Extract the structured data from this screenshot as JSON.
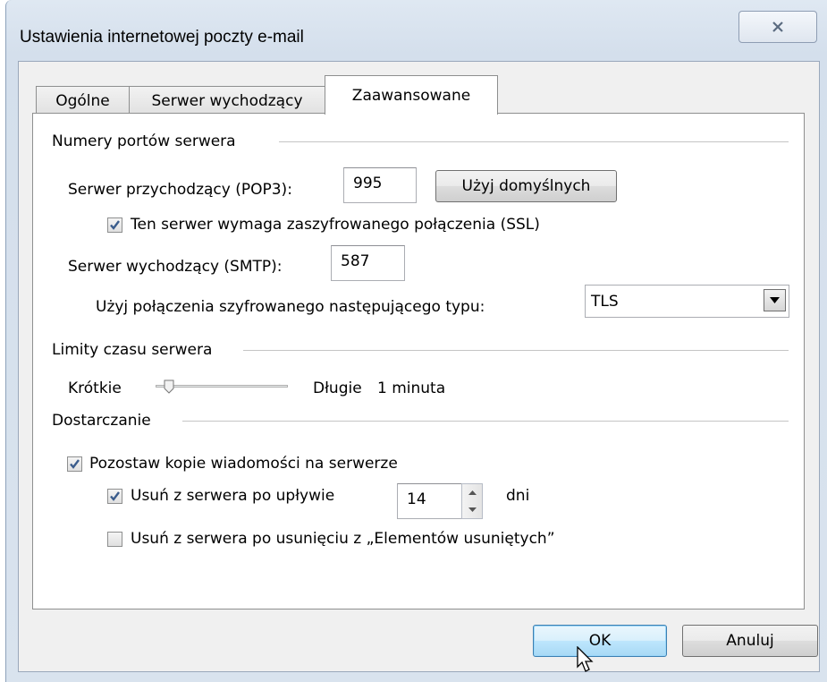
{
  "window": {
    "title": "Ustawienia internetowej poczty e-mail",
    "close_icon": "close-icon"
  },
  "tabs": [
    {
      "label": "Ogólne",
      "active": false
    },
    {
      "label": "Serwer wychodzący",
      "active": false
    },
    {
      "label": "Zaawansowane",
      "active": true
    }
  ],
  "ports": {
    "group_title": "Numery portów serwera",
    "incoming_label": "Serwer przychodzący (POP3):",
    "incoming_value": "995",
    "defaults_button": "Użyj domyślnych",
    "ssl_checkbox_label": "Ten serwer wymaga zaszyfrowanego połączenia (SSL)",
    "ssl_checked": true,
    "outgoing_label": "Serwer wychodzący (SMTP):",
    "outgoing_value": "587",
    "encryption_label": "Użyj połączenia szyfrowanego następującego typu:",
    "encryption_value": "TLS"
  },
  "timeouts": {
    "group_title": "Limity czasu serwera",
    "short_label": "Krótkie",
    "long_label": "Długie",
    "value_text": "1 minuta",
    "slider_fraction": 0.1
  },
  "delivery": {
    "group_title": "Dostarczanie",
    "leave_copy_label": "Pozostaw kopie wiadomości na serwerze",
    "leave_copy_checked": true,
    "remove_after_label": "Usuń z serwera po upływie",
    "remove_after_checked": true,
    "remove_after_days": "14",
    "days_unit": "dni",
    "remove_deleted_label": "Usuń z serwera po usunięciu z „Elementów usuniętych”",
    "remove_deleted_checked": false
  },
  "buttons": {
    "ok": "OK",
    "cancel": "Anuluj"
  },
  "colors": {
    "check_mark": "#3a5c8c",
    "default_button_border": "#3c7fb1"
  }
}
